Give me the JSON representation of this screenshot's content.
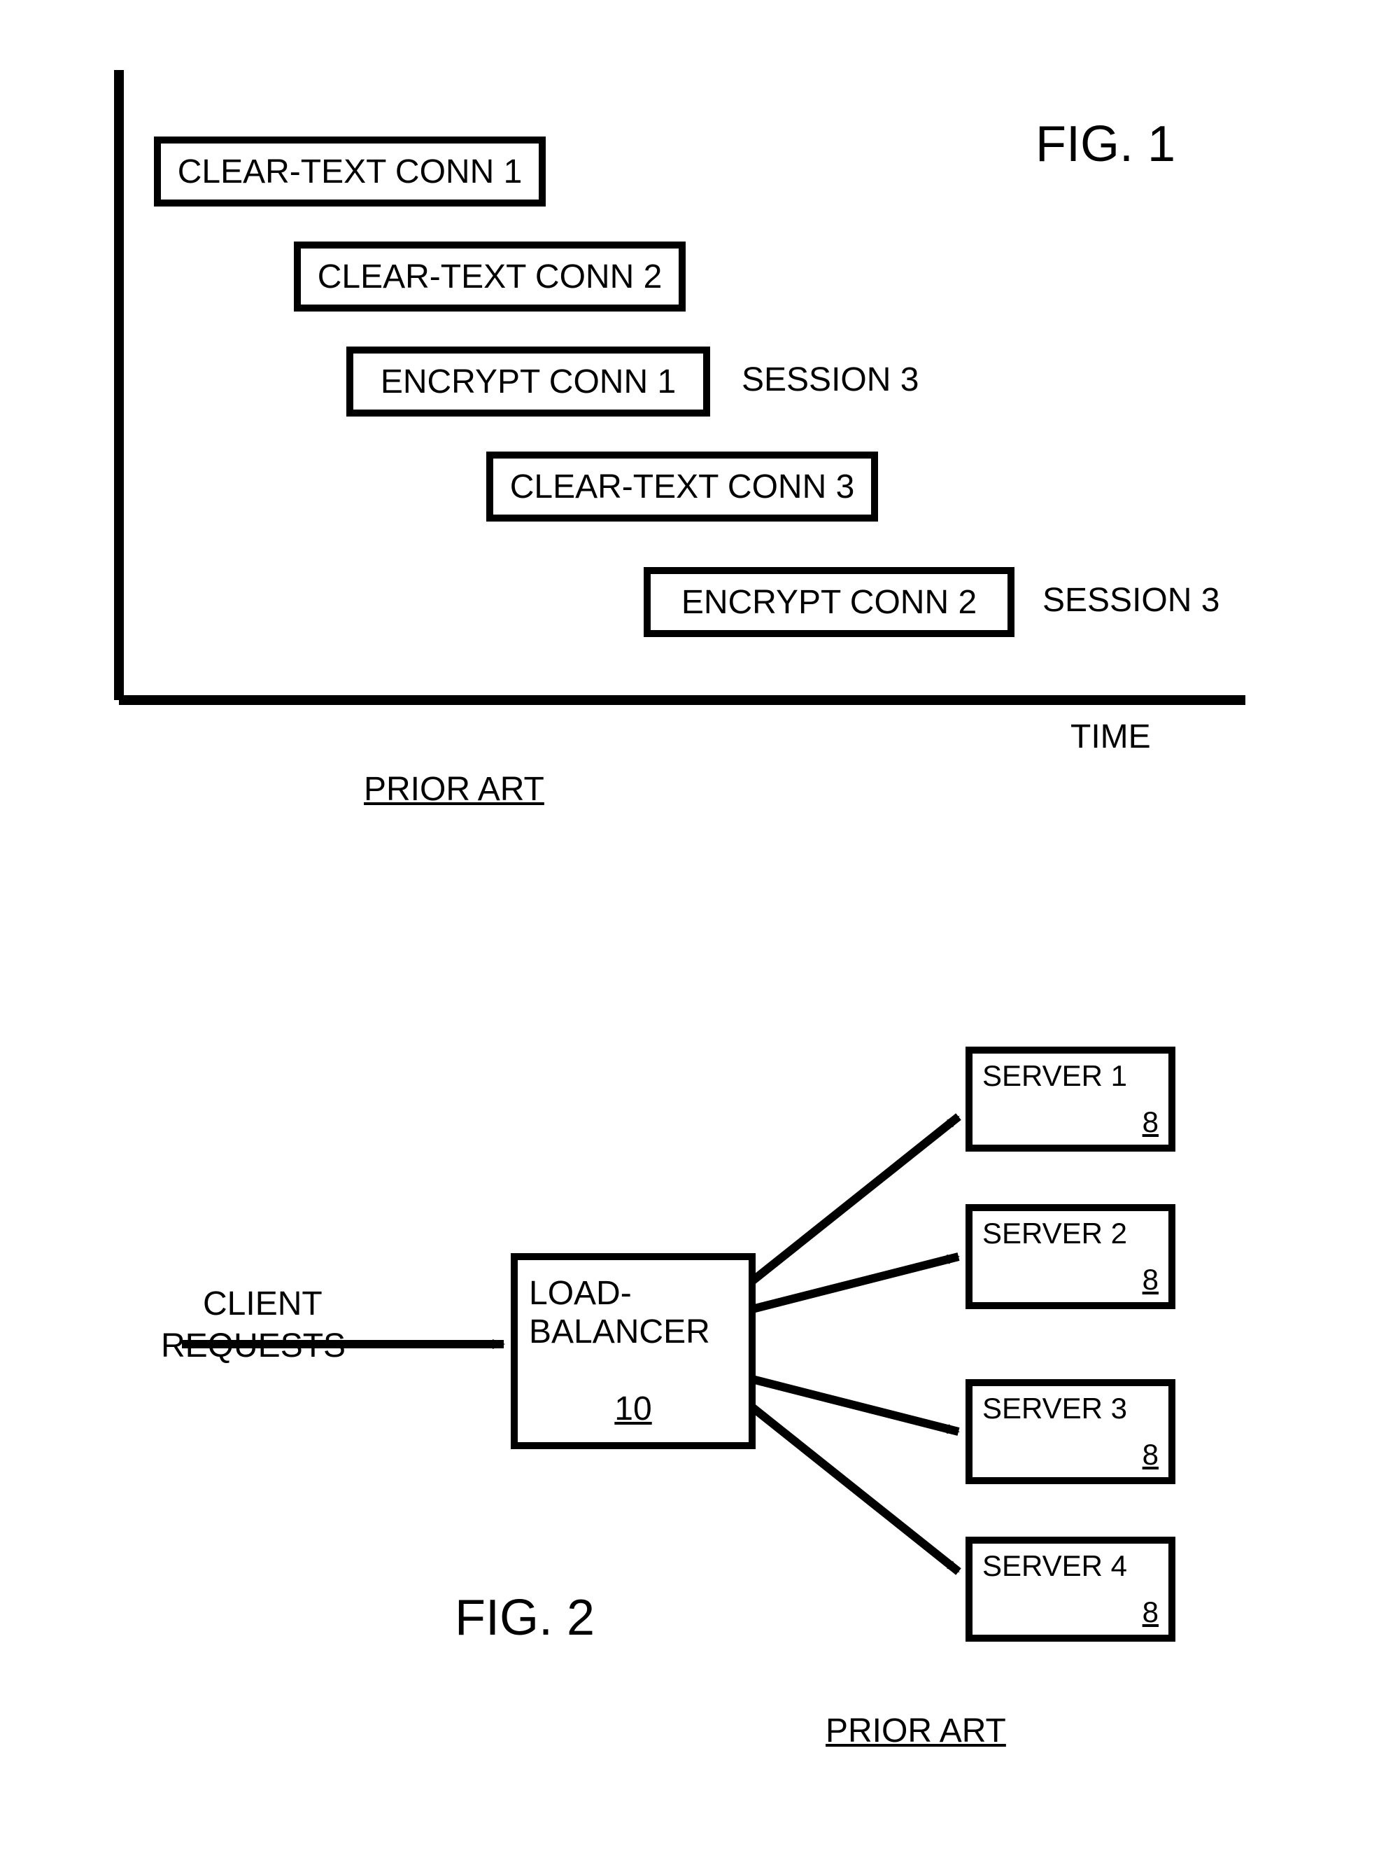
{
  "fig1": {
    "title": "FIG. 1",
    "axis_x_label": "TIME",
    "caption": "PRIOR ART",
    "bars": {
      "b1": "CLEAR-TEXT CONN 1",
      "b2": "CLEAR-TEXT CONN 2",
      "b3": "ENCRYPT CONN 1",
      "b4": "CLEAR-TEXT CONN 3",
      "b5": "ENCRYPT  CONN 2"
    },
    "side_labels": {
      "s3": "SESSION 3",
      "s5": "SESSION 3"
    }
  },
  "fig2": {
    "title": "FIG. 2",
    "caption": "PRIOR ART",
    "client_label_top": "CLIENT",
    "client_label_bot": "REQUESTS",
    "loadbalancer": {
      "label": "LOAD-\nBALANCER",
      "ref": "10"
    },
    "servers": {
      "s1": {
        "label": "SERVER 1",
        "ref": "8"
      },
      "s2": {
        "label": "SERVER 2",
        "ref": "8"
      },
      "s3": {
        "label": "SERVER 3",
        "ref": "8"
      },
      "s4": {
        "label": "SERVER 4",
        "ref": "8"
      }
    }
  }
}
